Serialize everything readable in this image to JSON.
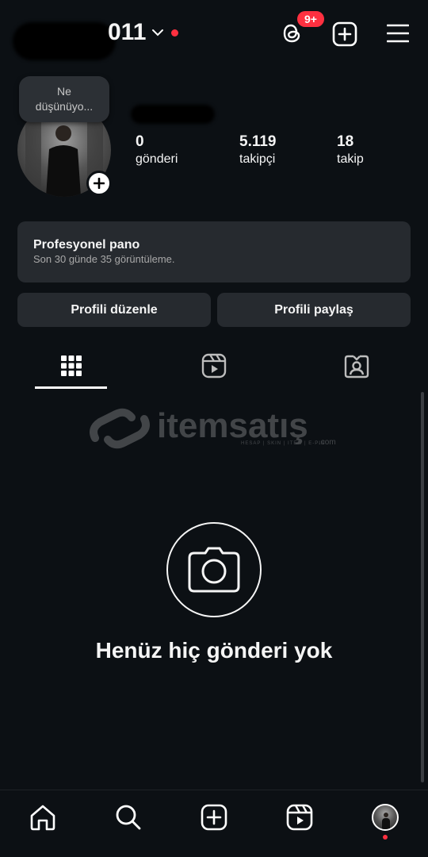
{
  "header": {
    "username_visible": "011",
    "notification_badge": "9+",
    "accent_red": "#ff3040"
  },
  "profile": {
    "note_text": "Ne düşünüyo...",
    "stats": [
      {
        "value": "0",
        "label": "gönderi"
      },
      {
        "value": "5.119",
        "label": "takipçi"
      },
      {
        "value": "18",
        "label": "takip"
      }
    ]
  },
  "dashboard": {
    "title": "Profesyonel pano",
    "subtitle": "Son 30 günde 35 görüntüleme."
  },
  "actions": {
    "edit_label": "Profili düzenle",
    "share_label": "Profili paylaş"
  },
  "tabs": {
    "icons": [
      "grid-icon",
      "reels-icon",
      "tagged-icon"
    ],
    "active_index": 0
  },
  "watermark": {
    "brand": "itemsatış",
    "tagline": "HESAP | SKIN | ITEM | E-PIN",
    "suffix": ".com"
  },
  "empty_state": {
    "message": "Henüz hiç gönderi yok"
  },
  "bottom_nav": {
    "icons": [
      "home-icon",
      "search-icon",
      "create-icon",
      "reels-icon",
      "profile-avatar"
    ]
  }
}
